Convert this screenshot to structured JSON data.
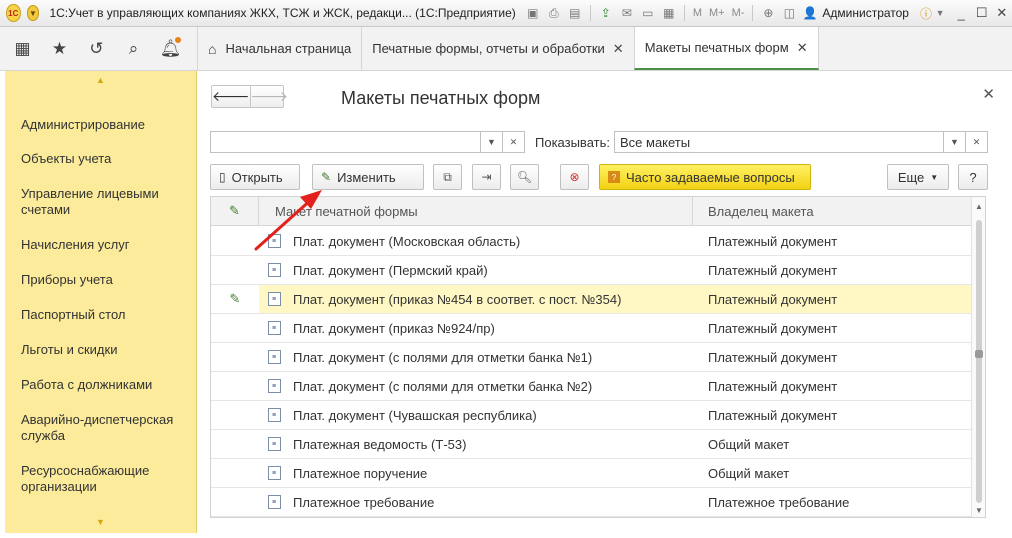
{
  "titlebar": {
    "logo": "1С",
    "title": "1С:Учет в управляющих компаниях ЖКХ, ТСЖ и ЖСК, редакци... (1С:Предприятие)",
    "icons": [
      "save-icon",
      "print-icon",
      "preview-icon",
      "upload-icon",
      "mail-icon",
      "calendar-icon"
    ],
    "mem_labels": [
      "M",
      "M+",
      "M-"
    ],
    "user": "Администратор"
  },
  "toolrow": {
    "tabs": [
      {
        "label": "Начальная страница",
        "home": true,
        "closable": false,
        "active": false
      },
      {
        "label": "Печатные формы, отчеты и обработки",
        "home": false,
        "closable": true,
        "active": false
      },
      {
        "label": "Макеты печатных форм",
        "home": false,
        "closable": true,
        "active": true
      }
    ]
  },
  "sidebar": {
    "items": [
      "Администрирование",
      "Объекты учета",
      "Управление лицевыми счетами",
      "Начисления услуг",
      "Приборы учета",
      "Паспортный стол",
      "Льготы и скидки",
      "Работа с должниками",
      "Аварийно-диспетчерская служба",
      "Ресурсоснабжающие организации"
    ]
  },
  "form": {
    "title": "Макеты печатных форм",
    "search_value": "",
    "show_label": "Показывать:",
    "show_value": "Все макеты",
    "buttons": {
      "open": "Открыть",
      "edit": "Изменить",
      "faq": "Часто задаваемые вопросы",
      "more": "Еще",
      "help": "?"
    }
  },
  "table": {
    "columns": [
      "Макет печатной формы",
      "Владелец макета"
    ],
    "rows": [
      {
        "name": "Плат. документ (Московская область)",
        "owner": "Платежный документ",
        "edited": false,
        "selected": false
      },
      {
        "name": "Плат. документ (Пермский край)",
        "owner": "Платежный документ",
        "edited": false,
        "selected": false
      },
      {
        "name": "Плат. документ (приказ №454 в соответ. с пост. №354)",
        "owner": "Платежный документ",
        "edited": true,
        "selected": true
      },
      {
        "name": "Плат. документ (приказ №924/пр)",
        "owner": "Платежный документ",
        "edited": false,
        "selected": false
      },
      {
        "name": "Плат. документ (с полями для отметки банка №1)",
        "owner": "Платежный документ",
        "edited": false,
        "selected": false
      },
      {
        "name": "Плат. документ (с полями для отметки банка №2)",
        "owner": "Платежный документ",
        "edited": false,
        "selected": false
      },
      {
        "name": "Плат. документ (Чувашская республика)",
        "owner": "Платежный документ",
        "edited": false,
        "selected": false
      },
      {
        "name": "Платежная ведомость (Т-53)",
        "owner": "Общий макет",
        "edited": false,
        "selected": false
      },
      {
        "name": "Платежное поручение",
        "owner": "Общий макет",
        "edited": false,
        "selected": false
      },
      {
        "name": "Платежное требование",
        "owner": "Платежное требование",
        "edited": false,
        "selected": false
      }
    ]
  },
  "colors": {
    "sidebar_bg": "#fbeb9b",
    "selected_row": "#fff8c4",
    "faq_button": "#f7e02a",
    "annotation_arrow": "#e3201b",
    "active_tab_underline": "#4a8e48"
  }
}
